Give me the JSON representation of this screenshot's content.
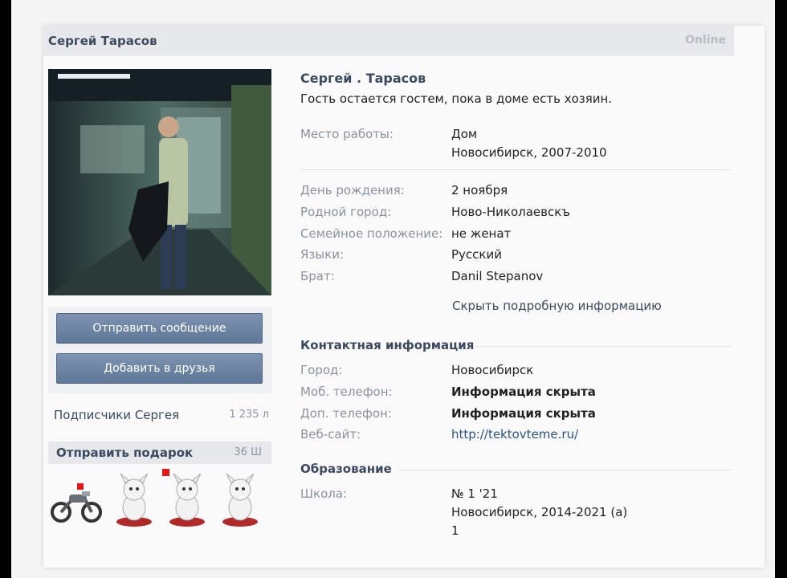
{
  "header": {
    "name": "Сергей Тарасов",
    "status": "Online"
  },
  "actions": {
    "send_message": "Отправить сообщение",
    "add_friend": "Добавить в друзья"
  },
  "subscribers": {
    "label": "Подписчики Сергея",
    "count": "1 235 л"
  },
  "gifts": {
    "label": "Отправить подарок",
    "count": "36 Ш"
  },
  "profile": {
    "name": "Сергей . Тарасов",
    "status": "Гость остается гостем, пока в доме есть хозяин.",
    "work": {
      "label": "Место работы:",
      "value": "Дом",
      "line2": "Новосибирск, 2007-2010"
    },
    "info": [
      {
        "label": "День рождения:",
        "value": "2 ноября"
      },
      {
        "label": "Родной город:",
        "value": "Ново-Николаевскъ"
      },
      {
        "label": "Семейное положение:",
        "value": "не женат"
      },
      {
        "label": "Языки:",
        "value": "Русский"
      },
      {
        "label": "Брат:",
        "value": "Danil Stepanov"
      }
    ],
    "hide_details": "Скрыть подробную информацию"
  },
  "contacts": {
    "title": "Контактная информация",
    "items": [
      {
        "label": "Город:",
        "value": "Новосибирск"
      },
      {
        "label": "Моб. телефон:",
        "value": "Информация скрыта"
      },
      {
        "label": "Доп. телефон:",
        "value": "Информация скрыта"
      },
      {
        "label": "Веб-сайт:",
        "value": "http://tektovteme.ru/"
      }
    ]
  },
  "education": {
    "title": "Образование",
    "school_label": "Школа:",
    "school_value": "№ 1 '21",
    "line2": "Новосибирск, 2014-2021 (а)",
    "line3": "1"
  },
  "colors": {
    "button": "#6a82a3",
    "link": "#2b5384",
    "label": "#8a929c",
    "header_bg": "#e6e8eb"
  }
}
